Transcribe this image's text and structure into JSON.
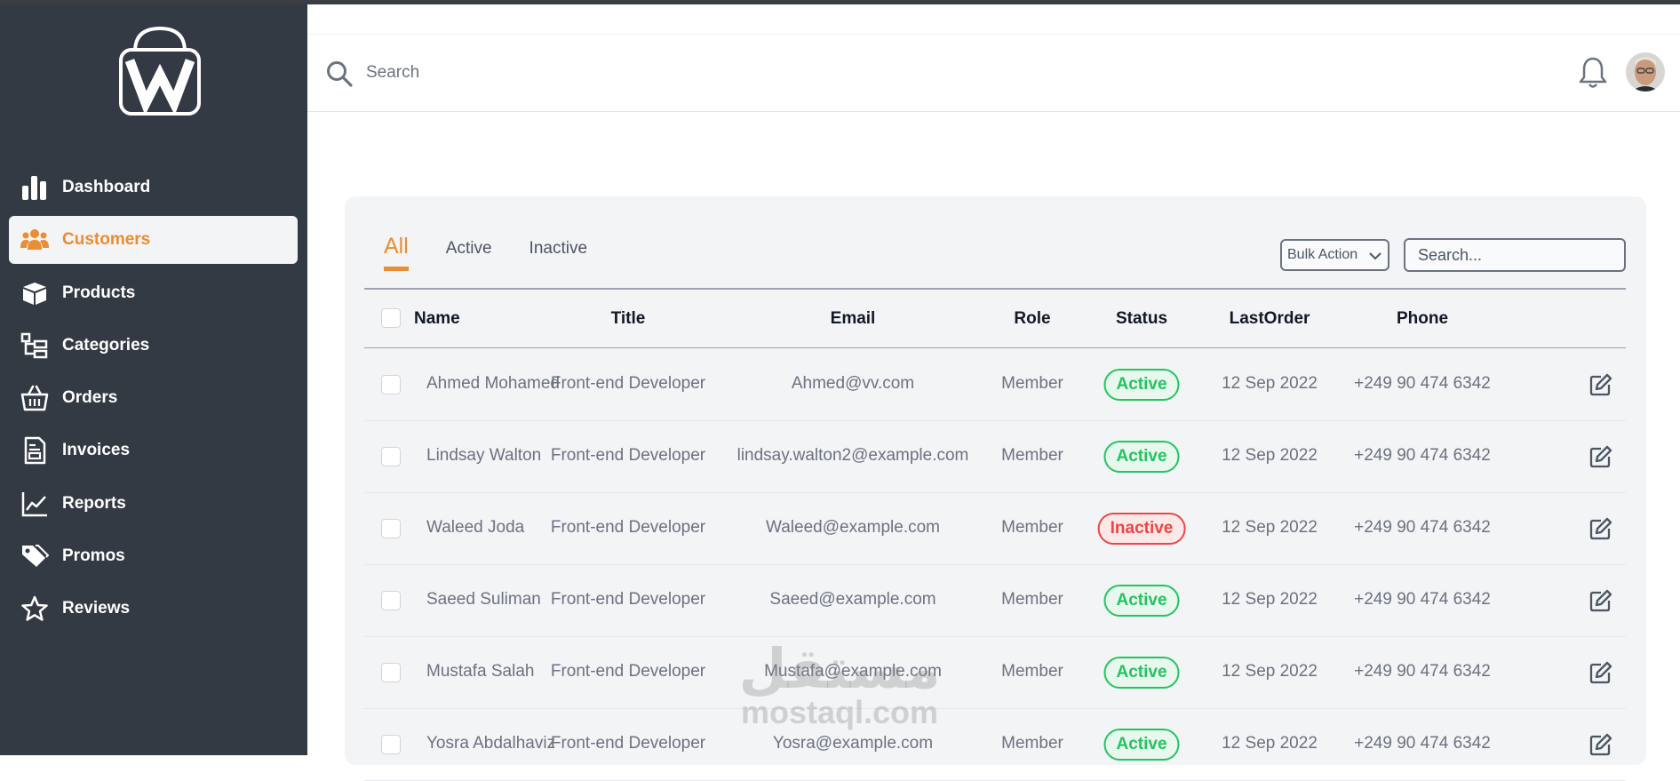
{
  "sidebar": {
    "items": [
      {
        "label": "Dashboard",
        "icon": "bar-chart-icon",
        "active": false
      },
      {
        "label": "Customers",
        "icon": "users-icon",
        "active": true
      },
      {
        "label": "Products",
        "icon": "box-icon",
        "active": false
      },
      {
        "label": "Categories",
        "icon": "sitemap-icon",
        "active": false
      },
      {
        "label": "Orders",
        "icon": "basket-icon",
        "active": false
      },
      {
        "label": "Invoices",
        "icon": "invoice-icon",
        "active": false
      },
      {
        "label": "Reports",
        "icon": "line-chart-icon",
        "active": false
      },
      {
        "label": "Promos",
        "icon": "tags-icon",
        "active": false
      },
      {
        "label": "Reviews",
        "icon": "star-icon",
        "active": false
      }
    ]
  },
  "topbar": {
    "search_placeholder": "Search"
  },
  "tabs": [
    {
      "label": "All",
      "active": true
    },
    {
      "label": "Active",
      "active": false
    },
    {
      "label": "Inactive",
      "active": false
    }
  ],
  "toolbar": {
    "bulk_action": "Bulk Action",
    "search_placeholder": "Search..."
  },
  "table": {
    "headers": [
      "Name",
      "Title",
      "Email",
      "Role",
      "Status",
      "LastOrder",
      "Phone"
    ],
    "rows": [
      {
        "name": "Ahmed Mohamed",
        "title": "Front-end Developer",
        "email": "Ahmed@vv.com",
        "role": "Member",
        "status": "Active",
        "last_order": "12 Sep 2022",
        "phone": "+249 90 474 6342"
      },
      {
        "name": "Lindsay Walton",
        "title": "Front-end Developer",
        "email": "lindsay.walton2@example.com",
        "role": "Member",
        "status": "Active",
        "last_order": "12 Sep 2022",
        "phone": "+249 90 474 6342"
      },
      {
        "name": "Waleed Joda",
        "title": "Front-end Developer",
        "email": "Waleed@example.com",
        "role": "Member",
        "status": "Inactive",
        "last_order": "12 Sep 2022",
        "phone": "+249 90 474 6342"
      },
      {
        "name": "Saeed Suliman",
        "title": "Front-end Developer",
        "email": "Saeed@example.com",
        "role": "Member",
        "status": "Active",
        "last_order": "12 Sep 2022",
        "phone": "+249 90 474 6342"
      },
      {
        "name": "Mustafa Salah",
        "title": "Front-end Developer",
        "email": "Mustafa@example.com",
        "role": "Member",
        "status": "Active",
        "last_order": "12 Sep 2022",
        "phone": "+249 90 474 6342"
      },
      {
        "name": "Yosra Abdalhaviz",
        "title": "Front-end Developer",
        "email": "Yosra@example.com",
        "role": "Member",
        "status": "Active",
        "last_order": "12 Sep 2022",
        "phone": "+249 90 474 6342"
      }
    ]
  },
  "watermark": {
    "arabic": "مستقل",
    "latin": "mostaql.com"
  },
  "colors": {
    "accent": "#ea8d33",
    "sidebar_bg": "#343a44",
    "active_green": "#22c55e",
    "inactive_red": "#ef4444"
  }
}
